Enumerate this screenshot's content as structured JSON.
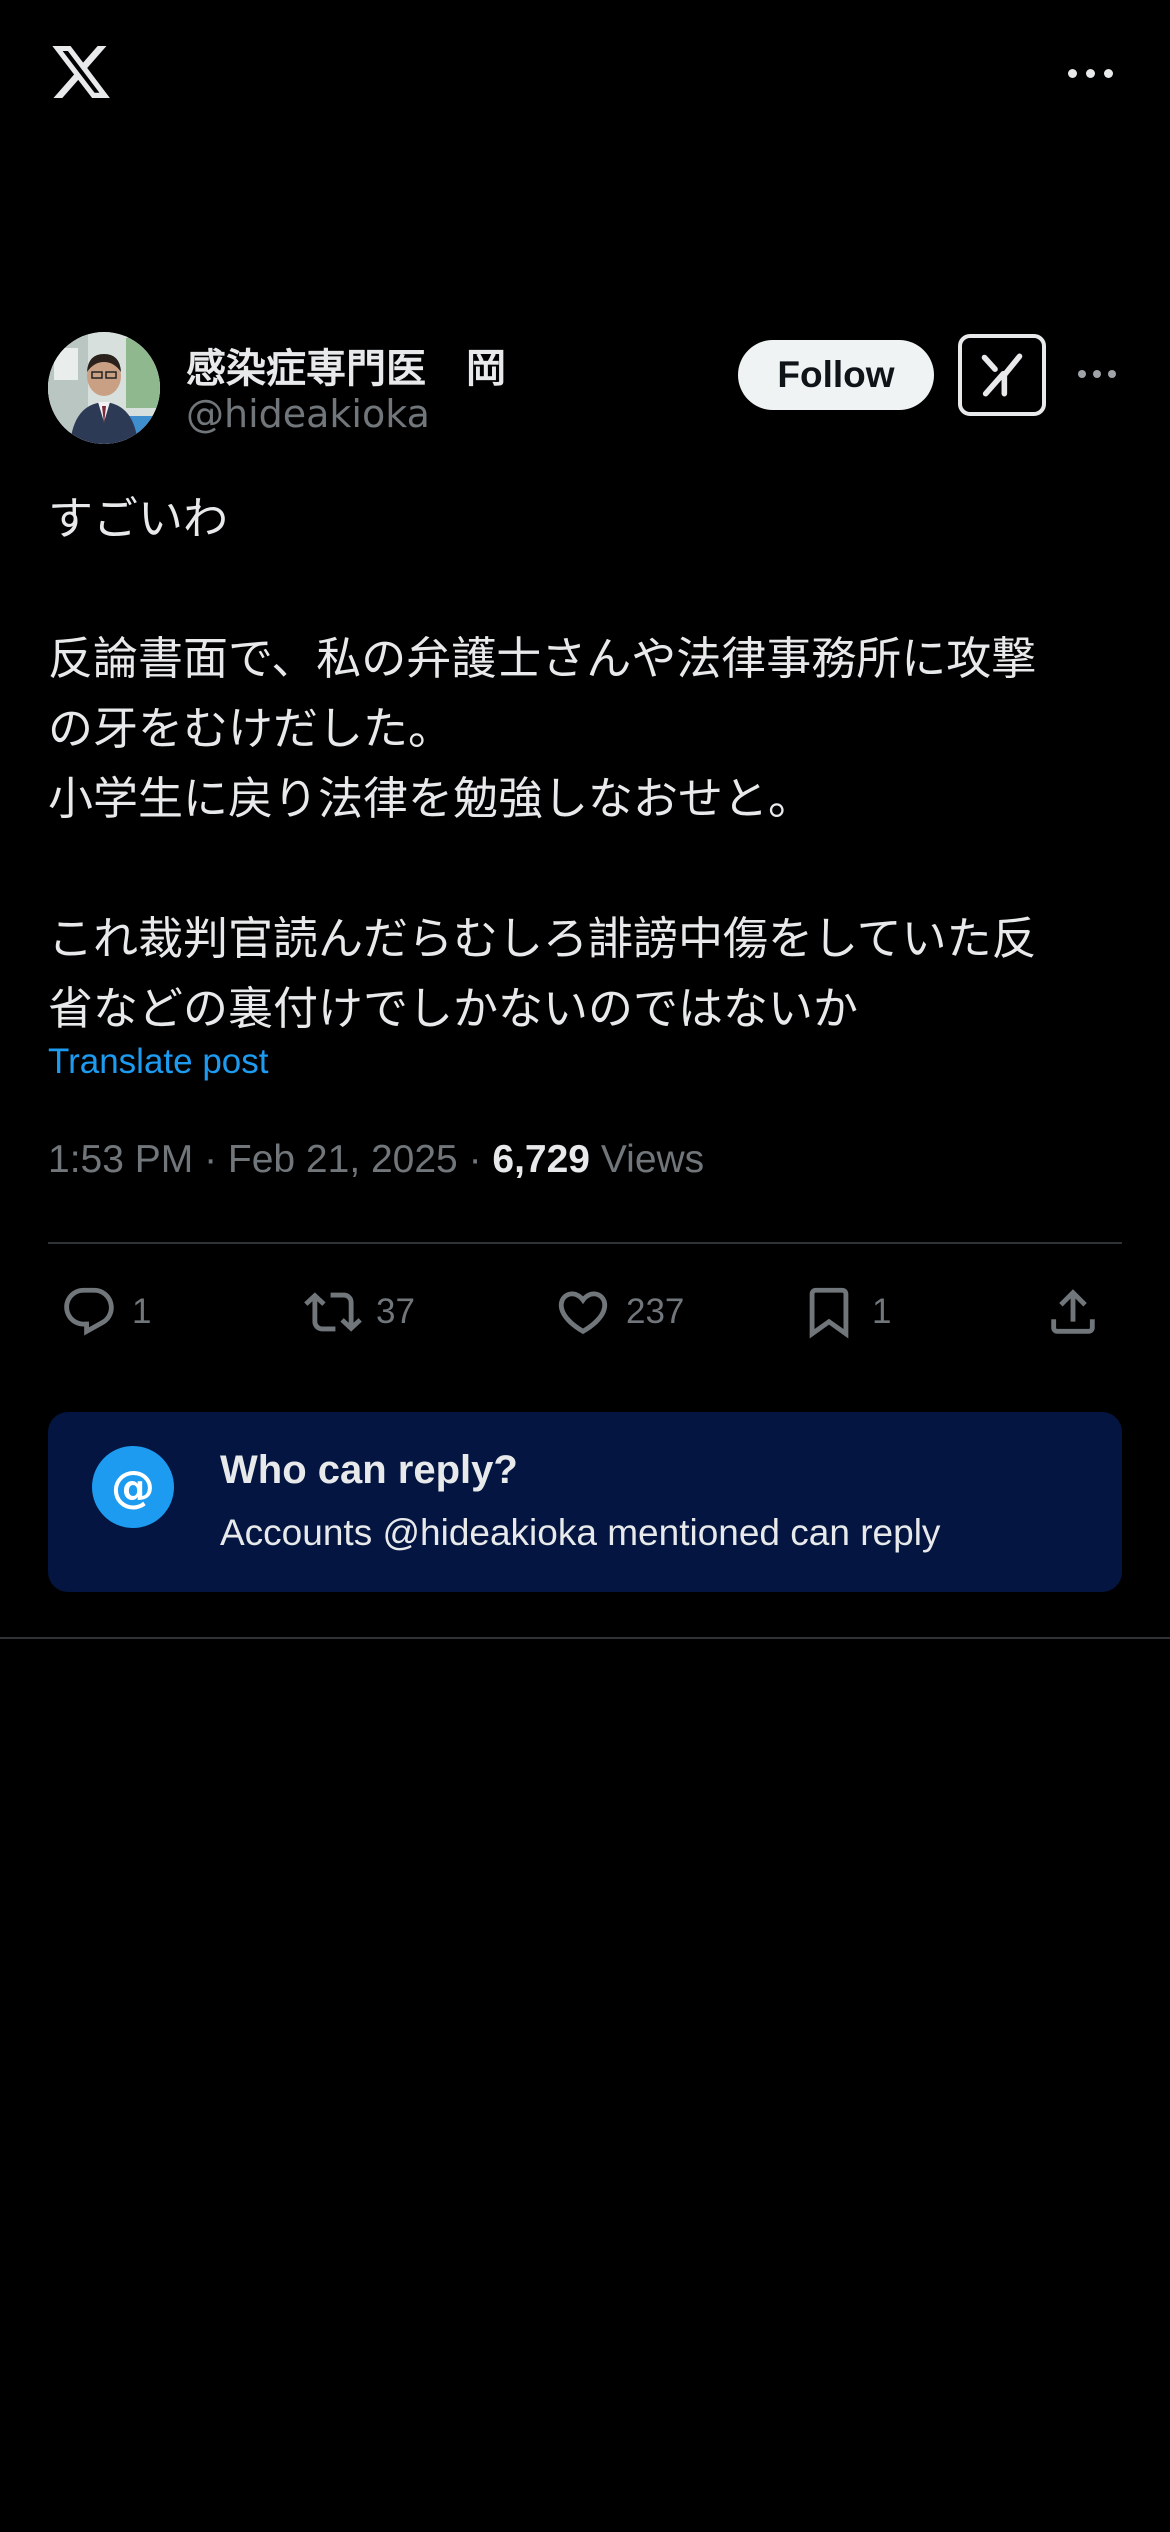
{
  "topbar": {
    "logo": "x-logo-icon",
    "more": "more-horizontal-icon"
  },
  "author": {
    "display_name": "感染症専門医　岡",
    "handle": "@hideakioka",
    "avatar": "profile-photo",
    "follow_label": "Follow",
    "grok": "grok-icon"
  },
  "post": {
    "lines": [
      "すごいわ",
      "",
      "反論書面で、私の弁護士さんや法律事務所に攻撃",
      "の牙をむけだした。",
      "小学生に戻り法律を勉強しなおせと。",
      "",
      "これ裁判官読んだらむしろ誹謗中傷をしていた反",
      "省などの裏付けでしかないのではないか"
    ],
    "translate_label": "Translate post",
    "timestamp": "1:53 PM · Feb 21, 2025 · ",
    "views_count": "6,729",
    "views_label": " Views"
  },
  "actions": {
    "replies": "1",
    "reposts": "37",
    "likes": "237",
    "bookmarks": "1"
  },
  "reply_restriction": {
    "icon": "at-sign-icon",
    "at_symbol": "@",
    "title": "Who can reply?",
    "description": "Accounts @hideakioka mentioned can reply"
  },
  "colors": {
    "background": "#000000",
    "accent": "#1d9bf0",
    "muted": "#71767b",
    "reply_box": "#031540"
  }
}
